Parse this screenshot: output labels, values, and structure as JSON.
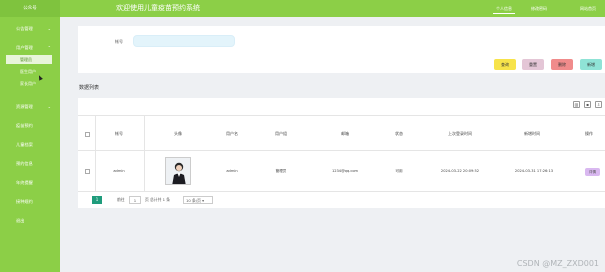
{
  "sidebar": {
    "logo": "公众号",
    "items": [
      {
        "label": "公告管理"
      },
      {
        "label": "用户管理"
      },
      {
        "label": "资源管理"
      },
      {
        "label": "疫苗预约"
      },
      {
        "label": "儿童档案"
      },
      {
        "label": "预约信息"
      },
      {
        "label": "年终提醒"
      },
      {
        "label": "接种规约"
      },
      {
        "label": "退出"
      }
    ],
    "sub_items": [
      {
        "label": "管理员"
      },
      {
        "label": "医生用户"
      },
      {
        "label": "家长用户"
      }
    ]
  },
  "header": {
    "title": "欢迎使用儿童疫苗预约系统",
    "links": [
      "个人信息",
      "修改密码",
      "网站首页"
    ]
  },
  "search": {
    "label": "帐号",
    "placeholder": "",
    "buttons": {
      "search": "查询",
      "reset": "重置",
      "delete": "删除",
      "add": "新增"
    }
  },
  "list": {
    "title": "数据列表",
    "columns": [
      "帐号",
      "头像",
      "用户名",
      "用户组",
      "邮箱",
      "状态",
      "上次登录时间",
      "新增时间",
      "操作"
    ],
    "rows": [
      {
        "account": "admin",
        "username": "admin",
        "group": "管理员",
        "email": "1234@qq.com",
        "status": "可用",
        "last_login": "2024-03-22 20:09:52",
        "created": "2024-03-31 17:26:13",
        "action": "详情"
      }
    ]
  },
  "pagination": {
    "current": "1",
    "goto_label": "前往",
    "page_input": "1",
    "total_text": "页 总计共 1 条",
    "page_size": "10 条/页"
  },
  "watermark": "CSDN @MZ_ZXD001",
  "colors": {
    "sidebar": "#8ccf47",
    "search_btn": "#f7e34a",
    "reset_btn": "#e4c6d6",
    "delete_btn": "#f08b8b",
    "add_btn": "#8fe3d6",
    "page_active": "#1f9c7c"
  }
}
